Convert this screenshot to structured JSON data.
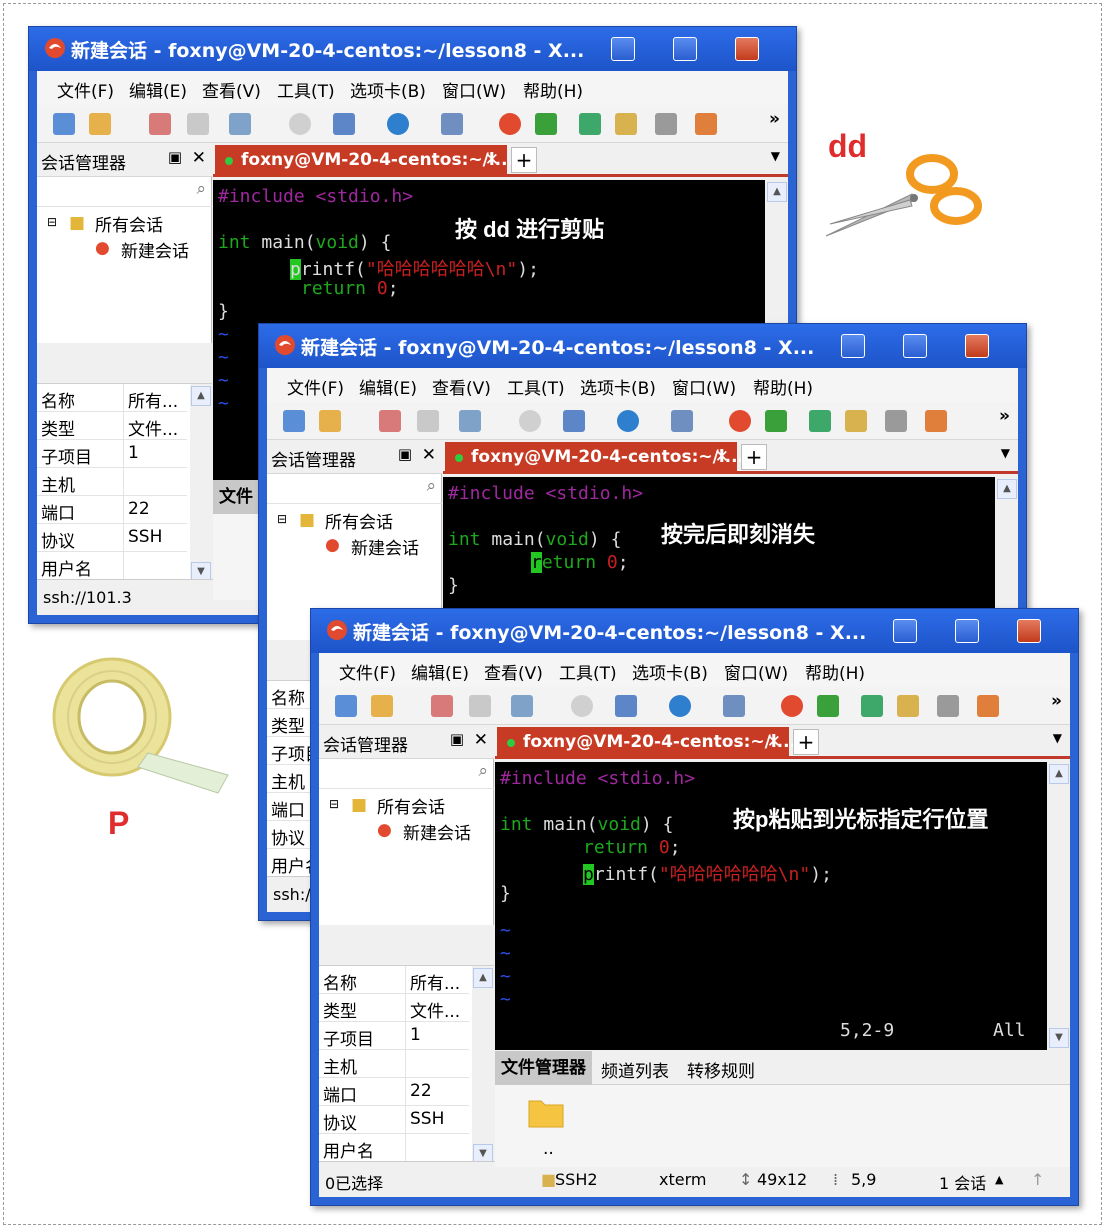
{
  "window": {
    "title": "新建会话 - foxny@VM-20-4-centos:~/lesson8 - X...",
    "menu": [
      "文件(F)",
      "编辑(E)",
      "查看(V)",
      "工具(T)",
      "选项卡(B)",
      "窗口(W)",
      "帮助(H)"
    ],
    "tab_label": "foxny@VM-20-4-centos:~/l...",
    "tab_close": "✕",
    "tab_add": "+",
    "toolbar_more": "»"
  },
  "sidebar": {
    "title": "会话管理器",
    "pin": "📌",
    "close": "✕",
    "tree_root": "所有会话",
    "tree_child": "新建会话"
  },
  "properties": [
    {
      "key": "名称",
      "value": "所有..."
    },
    {
      "key": "类型",
      "value": "文件..."
    },
    {
      "key": "子项目",
      "value": "1"
    },
    {
      "key": "主机",
      "value": ""
    },
    {
      "key": "端口",
      "value": "22"
    },
    {
      "key": "协议",
      "value": "SSH"
    },
    {
      "key": "用户名",
      "value": ""
    }
  ],
  "code": {
    "include": "#include <stdio.h>",
    "main_int": "int",
    "main_rest": " main(",
    "main_void": "void",
    "main_tail": ") {",
    "printf_first": "p",
    "printf_rest": "rintf(",
    "printf_str": "\"哈哈哈哈哈哈\\n\"",
    "printf_tail": ");",
    "return_kw": "return",
    "return_first": "r",
    "return_rest": "eturn",
    "return_val": " 0",
    "return_tail": ";",
    "close_brace": "}",
    "tilde": "~"
  },
  "annotations": {
    "win1": "按 dd 进行剪贴",
    "win2": "按完后即刻消失",
    "win3": "按p粘贴到光标指定行位置"
  },
  "vim_status": {
    "position": "5,2-9",
    "scroll": "All"
  },
  "file_manager": {
    "tabs": [
      "文件管理器",
      "频道列表",
      "转移规则"
    ],
    "short_tab": "文件",
    "entry": ".."
  },
  "status_bar": {
    "selected": "0已选择",
    "protocol": "SSH2",
    "terminal": "xterm",
    "size": "49x12",
    "cursor": "5,9",
    "sessions": "1 会话",
    "ssh_short": "ssh://101.3",
    "ssh_shorter": "ssh://"
  },
  "decorations": {
    "dd_label": "dd",
    "p_label": "P",
    "scissors_icon": "scissors",
    "tape_icon": "tape",
    "accent": "#c73a24"
  }
}
